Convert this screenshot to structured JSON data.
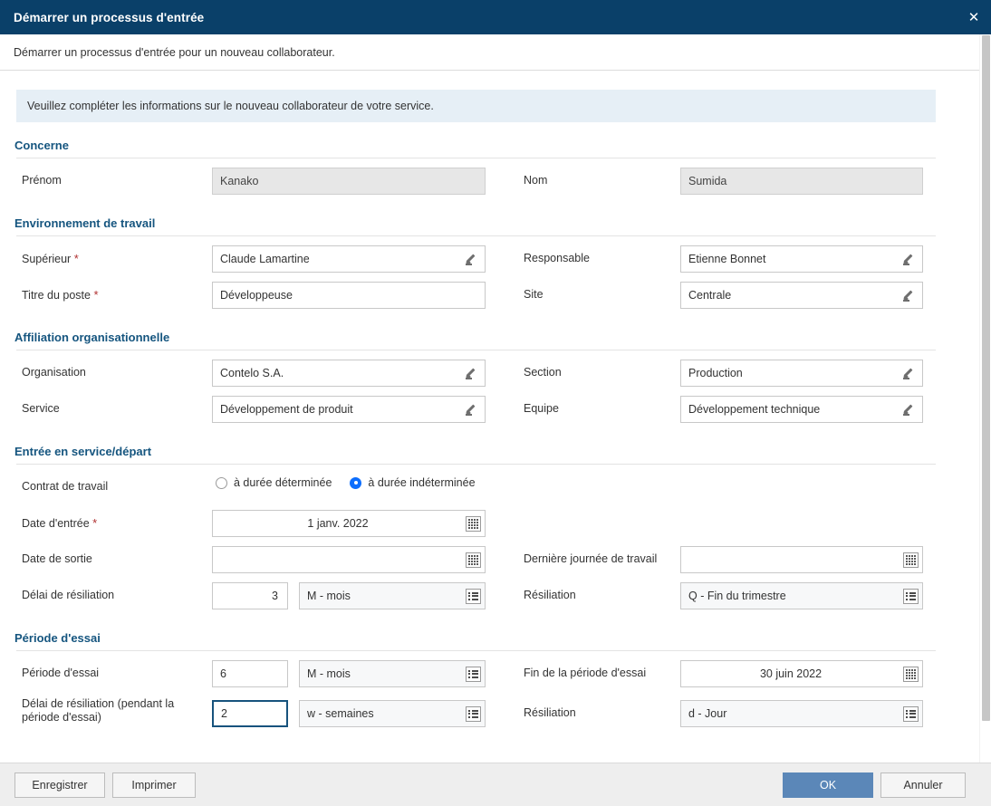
{
  "window": {
    "title": "Démarrer un processus d'entrée",
    "close_icon": "close-icon",
    "subtitle": "Démarrer un processus d'entrée pour un nouveau collaborateur.",
    "banner": "Veuillez compléter les informations sur le nouveau collaborateur de votre service.",
    "accent_titlebar": "#0a4069",
    "accent_section": "#15557f",
    "accent_primary_button": "#5b87b8",
    "accent_radio_selected": "#0d6efd",
    "accent_required": "#b03030",
    "banner_bg": "#e6eff6"
  },
  "sections": [
    {
      "title": "Concerne",
      "rows": [
        {
          "left": {
            "label": "Prénom",
            "required": false,
            "value": "Kanako",
            "style": "readonly",
            "icon": "none"
          },
          "right": {
            "label": "Nom",
            "required": false,
            "value": "Sumida",
            "style": "readonly",
            "icon": "none"
          }
        }
      ]
    },
    {
      "title": "Environnement de travail",
      "rows": [
        {
          "left": {
            "label": "Supérieur",
            "required": true,
            "value": "Claude Lamartine",
            "style": "input",
            "icon": "pencil-icon"
          },
          "right": {
            "label": "Responsable",
            "required": false,
            "value": "Etienne Bonnet",
            "style": "input",
            "icon": "pencil-icon"
          }
        },
        {
          "left": {
            "label": "Titre du poste",
            "required": true,
            "value": "Développeuse",
            "style": "input",
            "icon": "none"
          },
          "right": {
            "label": "Site",
            "required": false,
            "value": "Centrale",
            "style": "input",
            "icon": "pencil-icon"
          }
        }
      ]
    },
    {
      "title": "Affiliation organisationnelle",
      "rows": [
        {
          "left": {
            "label": "Organisation",
            "required": false,
            "value": "Contelo S.A.",
            "style": "input",
            "icon": "pencil-icon"
          },
          "right": {
            "label": "Section",
            "required": false,
            "value": "Production",
            "style": "input",
            "icon": "pencil-icon"
          }
        },
        {
          "left": {
            "label": "Service",
            "required": false,
            "value": "Développement de produit",
            "style": "input",
            "icon": "pencil-icon"
          },
          "right": {
            "label": "Equipe",
            "required": false,
            "value": "Développement technique",
            "style": "input",
            "icon": "pencil-icon"
          }
        }
      ]
    },
    {
      "title": "Entrée en service/départ",
      "contract": {
        "label": "Contrat de travail",
        "options": [
          {
            "label": "à durée déterminée",
            "selected": false
          },
          {
            "label": "à durée indéterminée",
            "selected": true
          }
        ]
      },
      "rows": [
        {
          "left": {
            "label": "Date d'entrée",
            "required": true,
            "value": "1 janv. 2022",
            "style": "input",
            "align": "center",
            "icon": "calendar-icon"
          },
          "right": null
        },
        {
          "left": {
            "label": "Date de sortie",
            "required": false,
            "value": "",
            "style": "input",
            "icon": "calendar-icon"
          },
          "right": {
            "label": "Dernière journée de travail",
            "required": false,
            "value": "",
            "style": "input",
            "icon": "calendar-icon"
          }
        }
      ],
      "duration_row": {
        "left_label": "Délai de résiliation",
        "left_number": "3",
        "left_number_align": "right",
        "left_unit": "M - mois",
        "right_label": "Résiliation",
        "right_unit": "Q - Fin du trimestre",
        "unit_icon": "list-icon"
      }
    },
    {
      "title": "Période d'essai",
      "rows_custom": [
        {
          "left_label": "Période d'essai",
          "left_number": "6",
          "left_number_align": "left",
          "left_number_focused": false,
          "left_unit": "M - mois",
          "right_label": "Fin de la période d'essai",
          "right_value": "30 juin 2022",
          "right_align": "center",
          "right_icon": "calendar-icon"
        },
        {
          "left_label": "Délai de résiliation (pendant la période d'essai)",
          "left_number": "2",
          "left_number_align": "left",
          "left_number_focused": true,
          "left_unit": "w - semaines",
          "right_label": "Résiliation",
          "right_value": "d - Jour",
          "right_align": "left",
          "right_icon": "list-icon"
        }
      ]
    }
  ],
  "footer": {
    "save_label": "Enregistrer",
    "print_label": "Imprimer",
    "ok_label": "OK",
    "cancel_label": "Annuler"
  }
}
